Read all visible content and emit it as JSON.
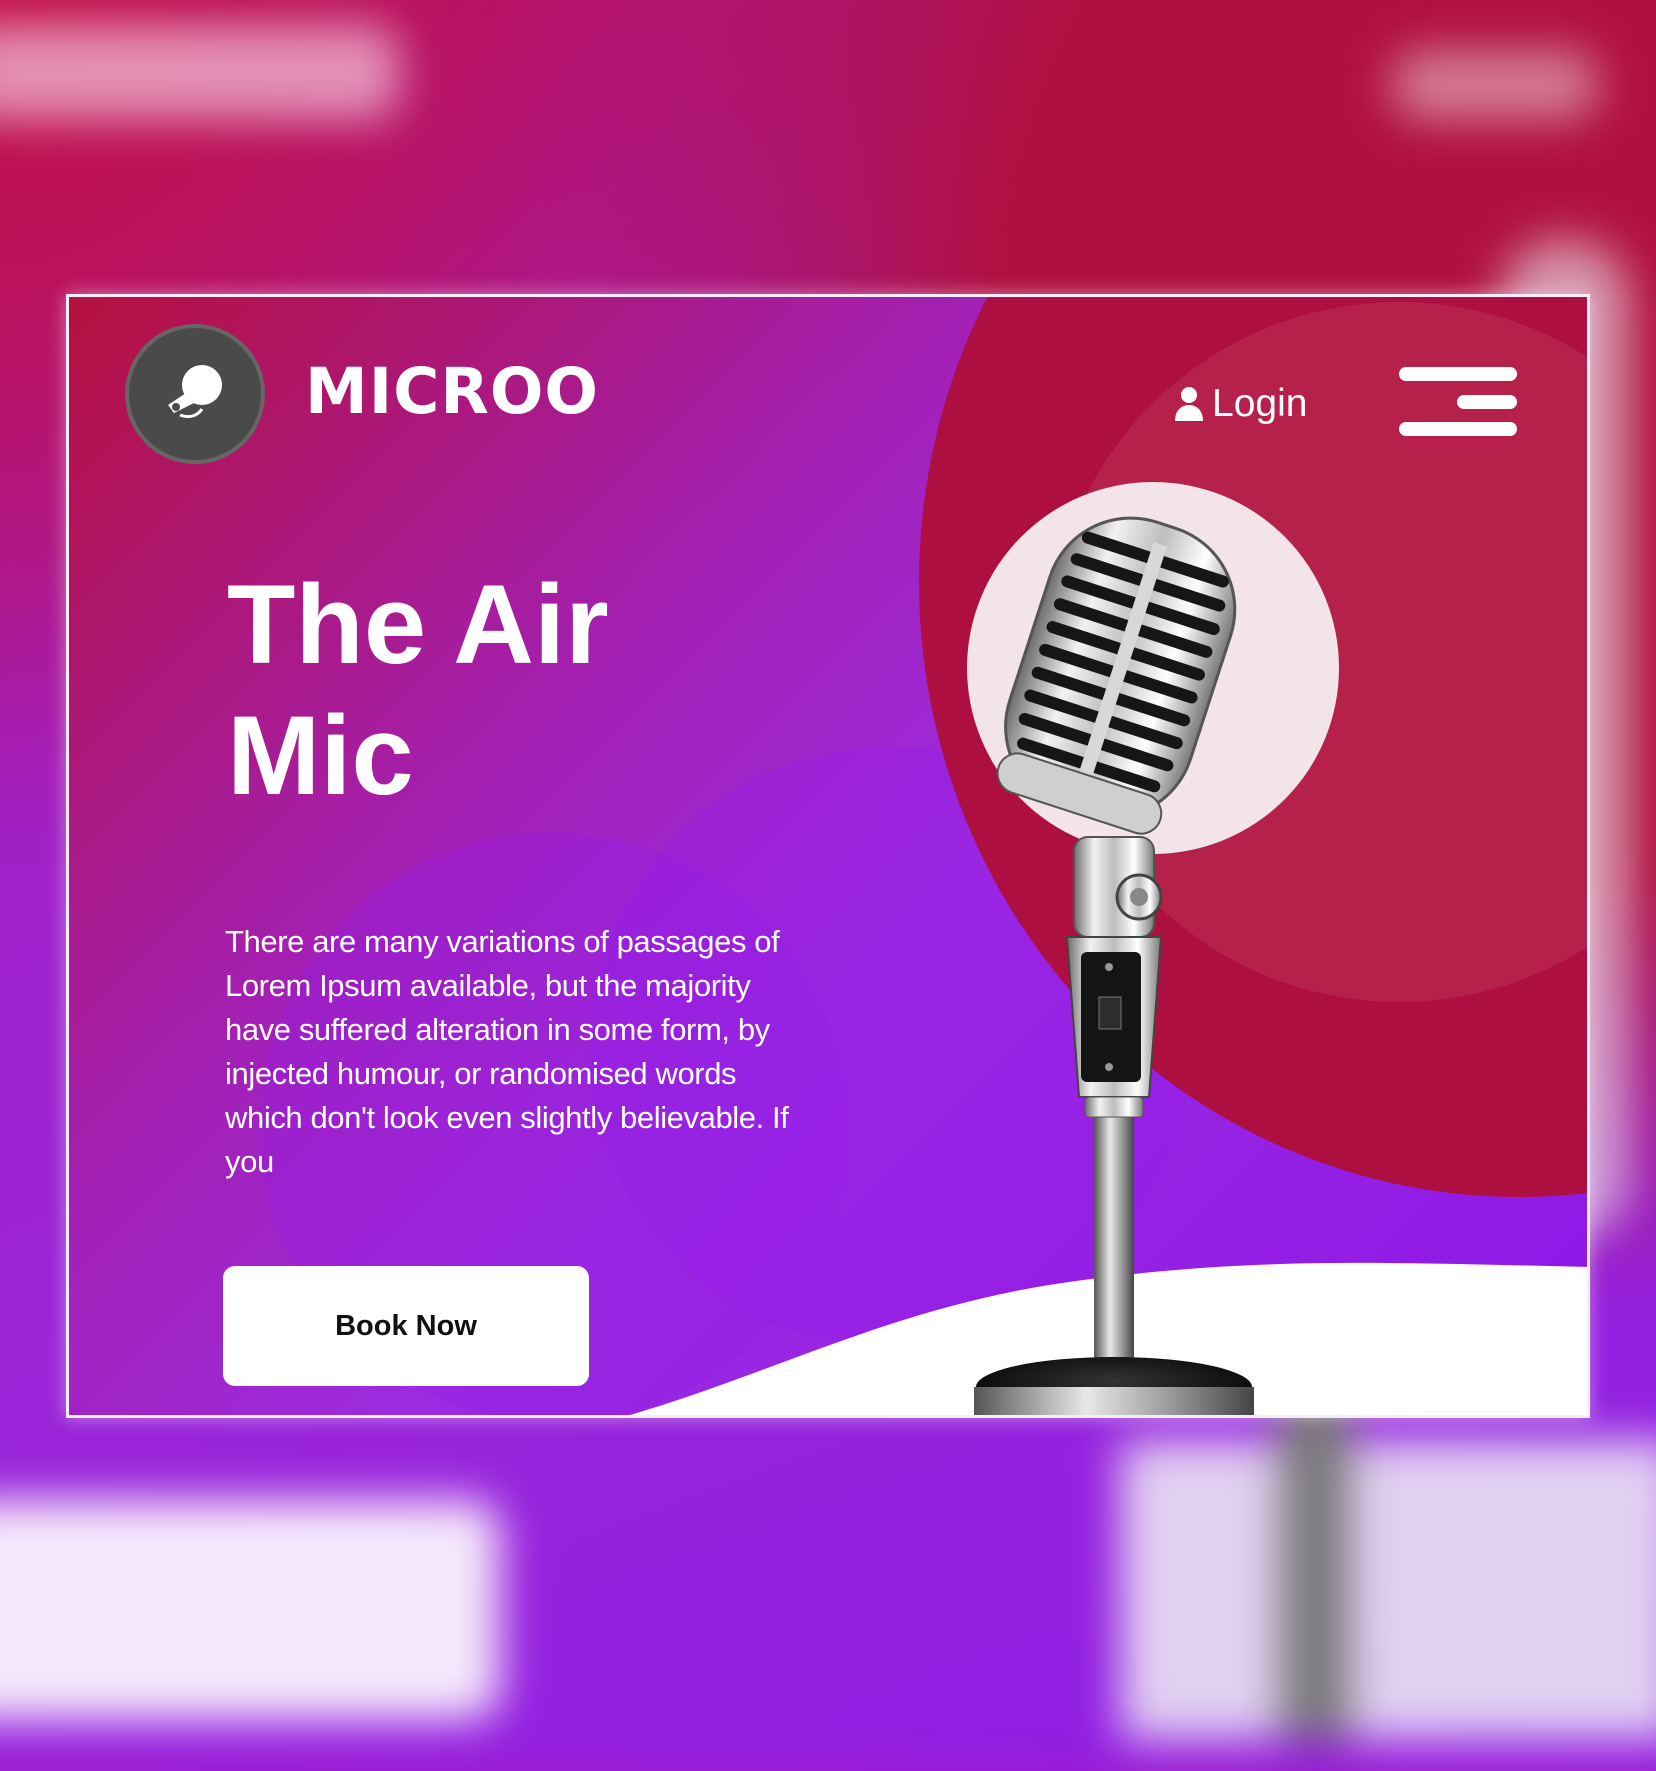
{
  "brand": {
    "name": "MICROO"
  },
  "header": {
    "login_label": "Login"
  },
  "hero": {
    "title_line1": "The Air",
    "title_line2": "Mic",
    "description": "There are many variations of passages of Lorem Ipsum available, but the majority have suffered alteration in some form, by injected humour, or randomised words which don't look even slightly believable. If you",
    "cta_label": "Book Now"
  },
  "icons": {
    "logo": "microphone-logo-icon",
    "login": "user-icon",
    "menu": "hamburger-menu-icon"
  },
  "colors": {
    "crimson": "#ad0f40",
    "purple": "#9c2be0",
    "violet": "#8e16e8",
    "white": "#ffffff"
  }
}
